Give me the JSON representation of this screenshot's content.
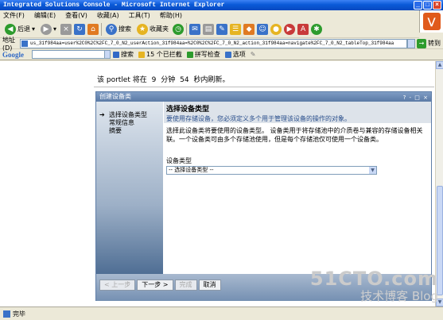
{
  "window": {
    "title": "Integrated Solutions Console - Microsoft Internet Explorer"
  },
  "menu": {
    "items": [
      "文件(F)",
      "编辑(E)",
      "查看(V)",
      "收藏(A)",
      "工具(T)",
      "帮助(H)"
    ]
  },
  "toolbar": {
    "back": "后退",
    "search": "搜索",
    "favorites": "收藏夹"
  },
  "address": {
    "label": "地址(D)",
    "url": "us_31f984aa=user%2C0%2C%2FC_7_0_N2_userAction_31f984aa=%2C0%2C%2FC_7_0_N2_action_31f984aa=navigate%2FC_7_0_N2_tableTop_31f984aa",
    "go": "转到"
  },
  "google": {
    "logo": "Google",
    "search": "搜索",
    "blocked": "15 个已拦截",
    "spell": "拼写检查",
    "options": "选项"
  },
  "page": {
    "refresh_prefix": "该 portlet 将在",
    "refresh_minutes": "9",
    "refresh_min_unit": "分钟",
    "refresh_seconds": "54",
    "refresh_suffix": "秒内刷新。"
  },
  "portlet": {
    "title": "创建设备类",
    "header_icons": "? - □ ×",
    "nav": [
      "选择设备类型",
      "常规信息",
      "摘要"
    ],
    "step_title": "选择设备类型",
    "step_subtitle": "要使用存储设备，您必须定义多个用于管理该设备的操作的对象。",
    "description": "选择此设备类将要使用的设备类型。 设备类用于将存储池中的介质卷与兼容的存储设备相关联。一个设备类可由多个存储池使用，但是每个存储池仅可使用一个设备类。",
    "field_label": "设备类型",
    "select_value": "-- 选择设备类型 --",
    "buttons": {
      "prev": "< 上一步",
      "next": "下一步 >",
      "finish": "完成",
      "cancel": "取消"
    }
  },
  "status": {
    "text": "完毕"
  },
  "watermark": {
    "main": "51CTO.com",
    "sub": "技术博客 Blog"
  }
}
